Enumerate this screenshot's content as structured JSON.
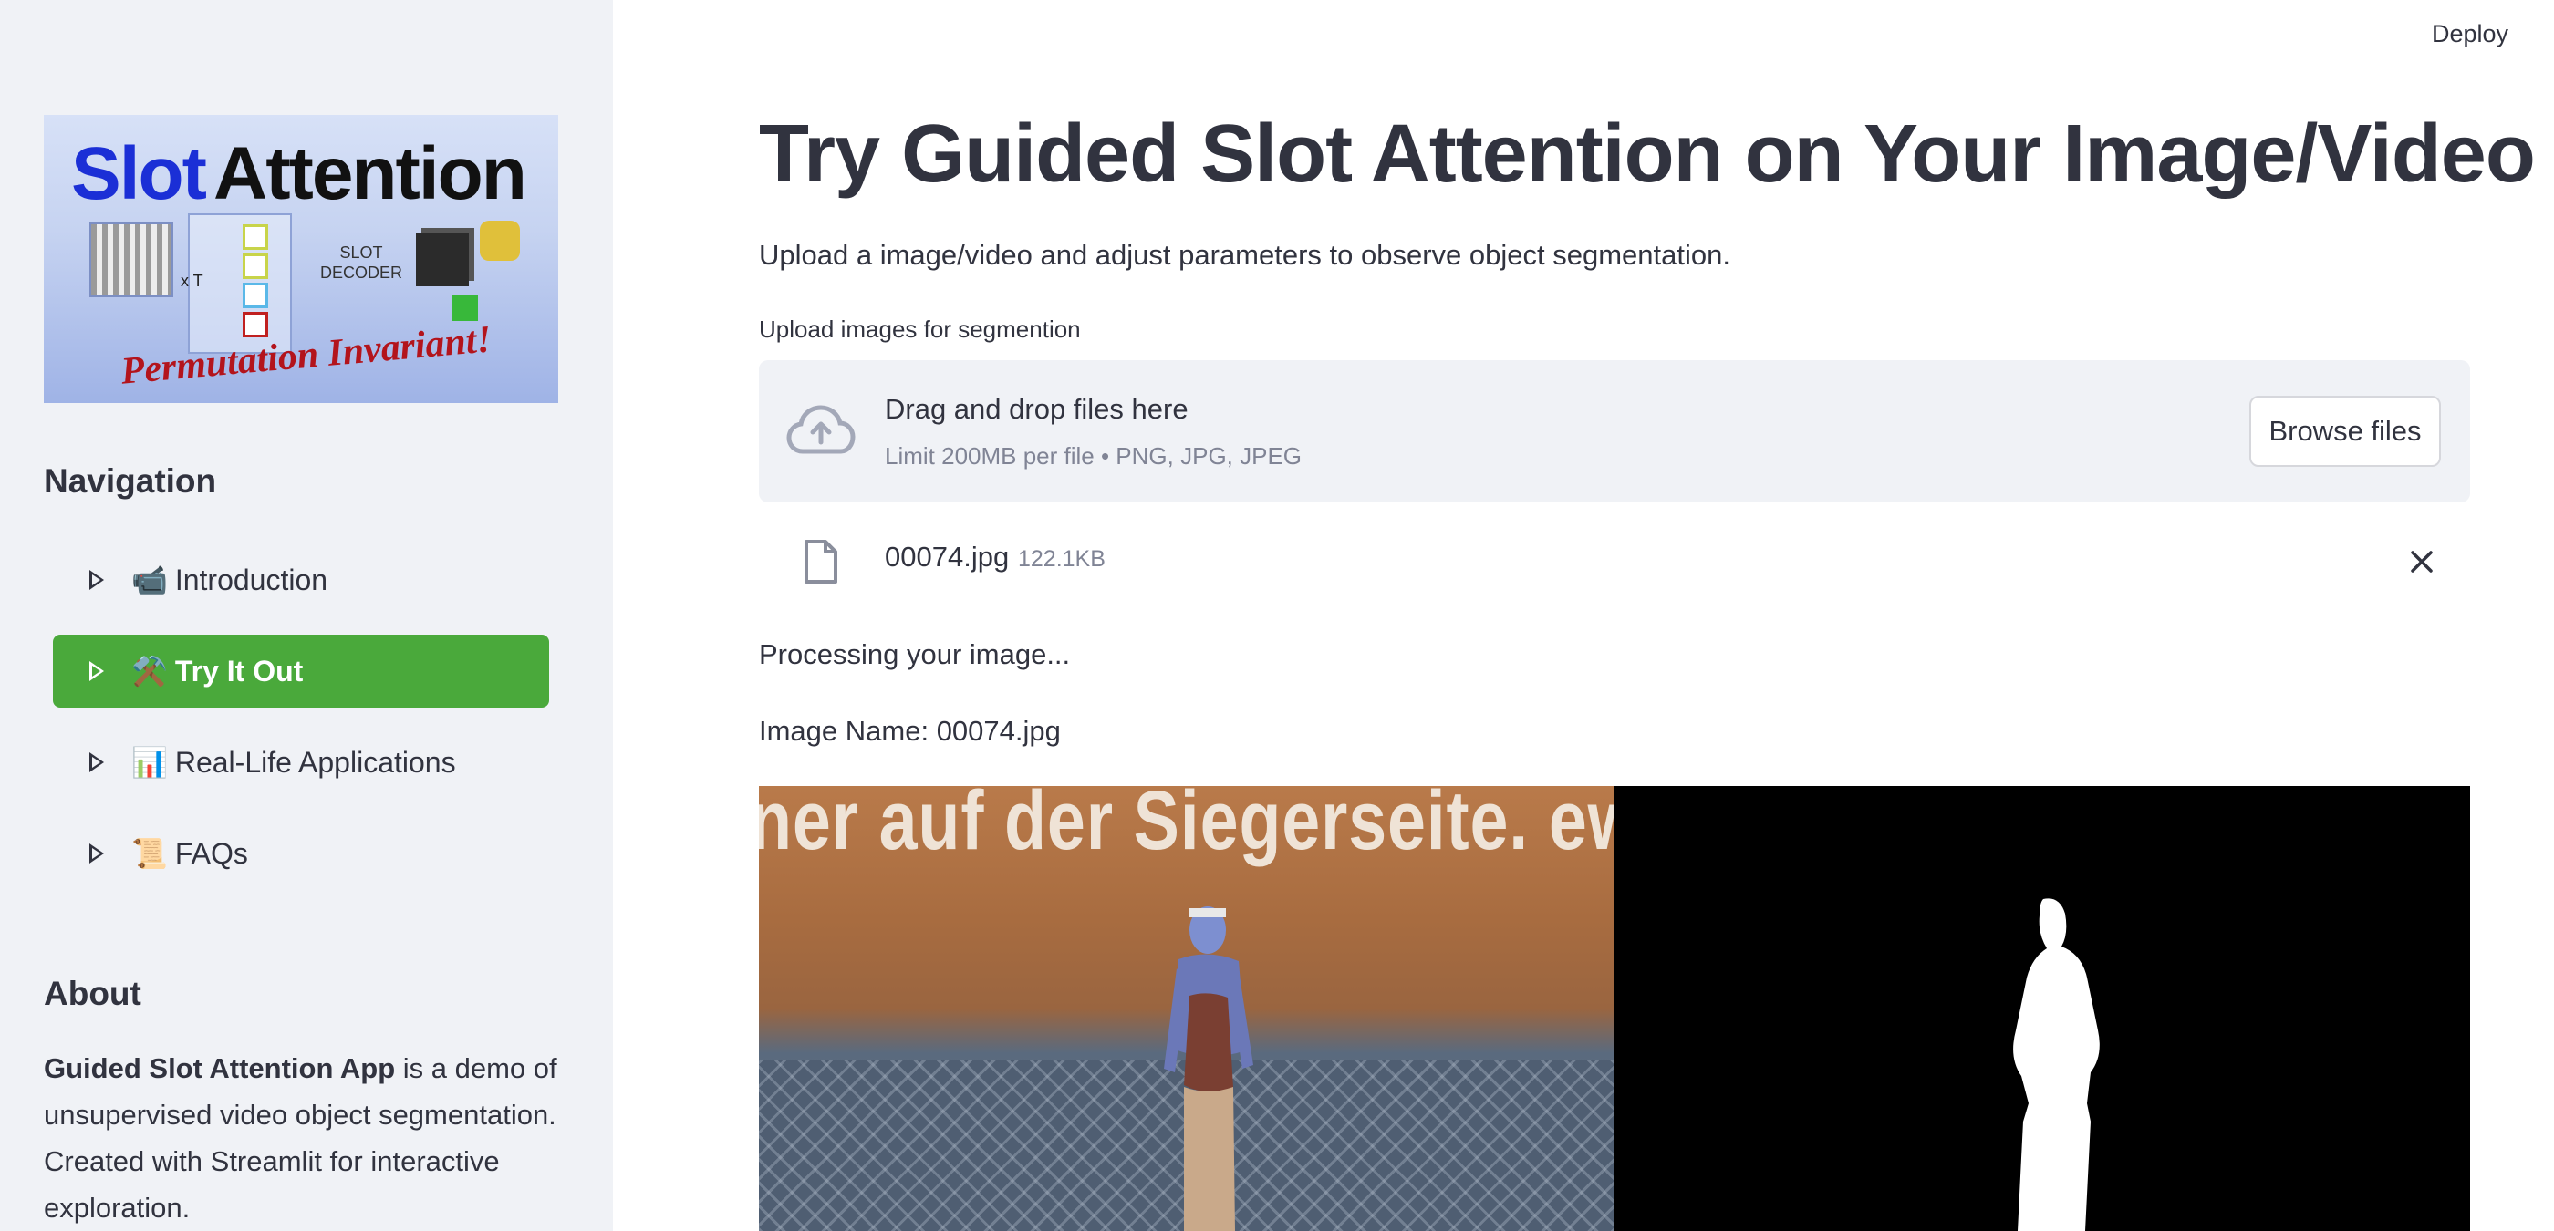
{
  "header": {
    "deploy_label": "Deploy"
  },
  "sidebar": {
    "logo": {
      "title_part1": "Slot",
      "title_part2": "Attention",
      "decoder_label": "SLOT DECODER",
      "tagline": "Permutation Invariant!",
      "loop_label": "x T"
    },
    "navigation_title": "Navigation",
    "items": [
      {
        "emoji": "📹",
        "label": "Introduction",
        "active": false
      },
      {
        "emoji": "⚒️",
        "label": "Try It Out",
        "active": true
      },
      {
        "emoji": "📊",
        "label": "Real-Life Applications",
        "active": false
      },
      {
        "emoji": "📜",
        "label": "FAQs",
        "active": false
      }
    ],
    "about_title": "About",
    "about_bold": "Guided Slot Attention App",
    "about_rest": " is a demo of unsupervised video object segmentation. Created with Streamlit for interactive exploration."
  },
  "main": {
    "title": "Try Guided Slot Attention on Your Image/Video",
    "subtitle": "Upload a image/video and adjust parameters to observe object segmentation.",
    "uploader": {
      "label": "Upload images for segmention",
      "drop_text": "Drag and drop files here",
      "limit_text": "Limit 200MB per file • PNG, JPG, JPEG",
      "browse_label": "Browse files"
    },
    "file": {
      "name": "00074.jpg",
      "size": "122.1KB"
    },
    "processing_text": "Processing your image...",
    "image_name_text": "Image Name: 00074.jpg",
    "original_image": {
      "banner_text": "ner auf der Siegerseite. ewz"
    }
  },
  "colors": {
    "sidebar_bg": "#f0f2f6",
    "active_nav": "#4aa93b",
    "text": "#31333f",
    "muted": "#808495"
  }
}
